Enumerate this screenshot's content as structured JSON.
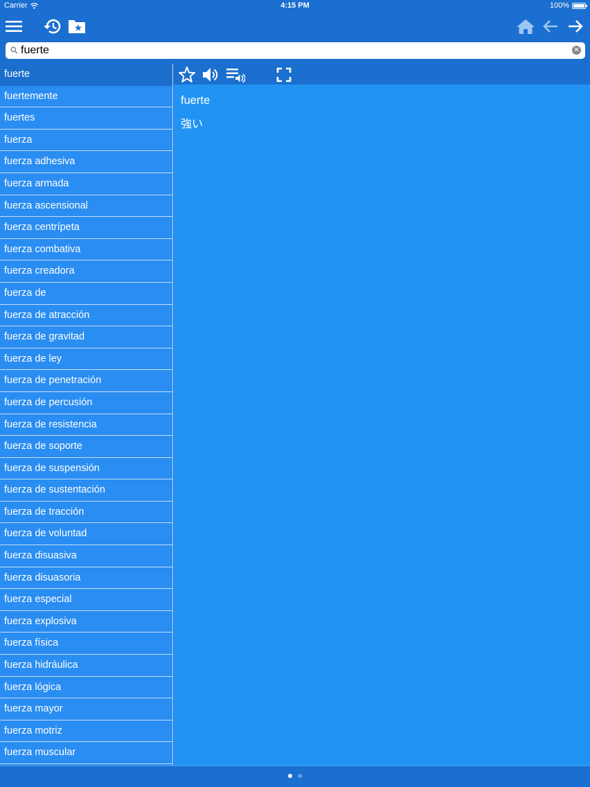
{
  "status_bar": {
    "carrier": "Carrier",
    "time": "4:15 PM",
    "battery": "100%"
  },
  "toolbar": {
    "icons": [
      "menu-icon",
      "history-icon",
      "favorites-folder-icon",
      "home-icon",
      "back-arrow-icon",
      "forward-arrow-icon"
    ]
  },
  "search": {
    "value": "fuerte",
    "placeholder": ""
  },
  "word_list": [
    "fuerte",
    "fuertemente",
    "fuertes",
    "fuerza",
    "fuerza adhesiva",
    "fuerza armada",
    "fuerza ascensional",
    "fuerza centrípeta",
    "fuerza combativa",
    "fuerza creadora",
    "fuerza de",
    "fuerza de atracción",
    "fuerza de gravitad",
    "fuerza de ley",
    "fuerza de penetración",
    "fuerza de percusión",
    "fuerza de resistencia",
    "fuerza de soporte",
    "fuerza de suspensión",
    "fuerza de sustentación",
    "fuerza de tracción",
    "fuerza de voluntad",
    "fuerza disuasiva",
    "fuerza disuasoria",
    "fuerza especial",
    "fuerza explosiva",
    "fuerza física",
    "fuerza hidráulica",
    "fuerza lógica",
    "fuerza mayor",
    "fuerza motriz",
    "fuerza muscular"
  ],
  "selected_index": 0,
  "detail": {
    "word": "fuerte",
    "translation": "強い",
    "icons": [
      "star-icon",
      "speaker-icon",
      "playlist-audio-icon",
      "fullscreen-icon"
    ]
  },
  "page_dots": {
    "count": 2,
    "active": 0
  },
  "colors": {
    "bar": "#1a6fd0",
    "list_bg": "#2a8df2",
    "detail_bg": "#2194f3",
    "selected": "#1b6ecc"
  }
}
